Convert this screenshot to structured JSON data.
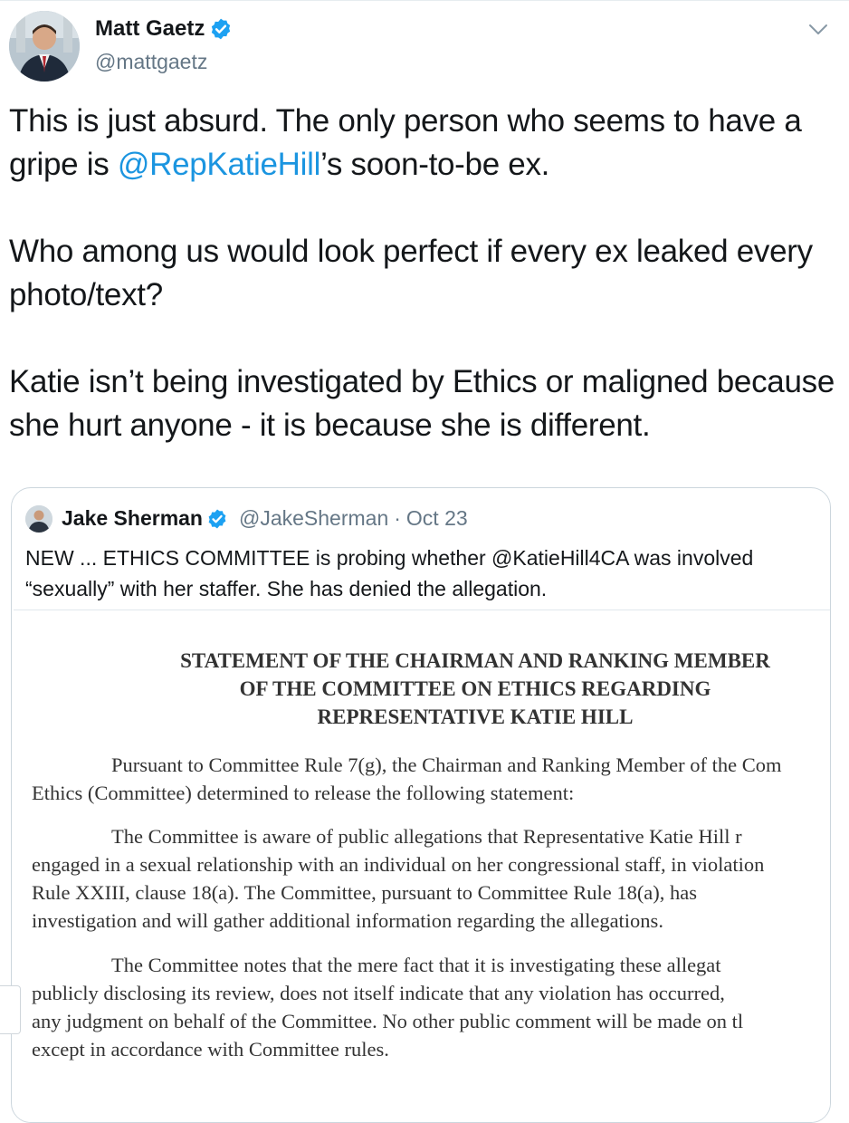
{
  "author": {
    "display_name": "Matt Gaetz",
    "handle": "@mattgaetz"
  },
  "tweet": {
    "p1_before": "This is just absurd. The only person who seems to have a gripe is ",
    "p1_mention": "@RepKatieHill",
    "p1_after": "’s soon-to-be ex.",
    "p2": "Who among us would look perfect if every ex leaked every photo/text?",
    "p3": "Katie isn’t being investigated by Ethics or maligned because she hurt anyone - it is because she is different."
  },
  "quoted": {
    "display_name": "Jake Sherman",
    "handle": "@JakeSherman",
    "separator": "·",
    "date": "Oct 23",
    "text": "NEW ... ETHICS COMMITTEE is probing whether @KatieHill4CA was involved “sexually” with her staffer. She has denied the allegation."
  },
  "document": {
    "title_lines": [
      "STATEMENT OF THE CHAIRMAN AND RANKING MEMBER",
      "OF THE COMMITTEE ON ETHICS REGARDING",
      "REPRESENTATIVE KATIE HILL"
    ],
    "lines": [
      "Pursuant to Committee Rule 7(g), the Chairman and Ranking Member of the Com",
      "Ethics (Committee) determined to release the following statement:",
      "The Committee is aware of public allegations that Representative Katie Hill r",
      "engaged in a sexual relationship with an individual on her congressional staff, in violation",
      "Rule XXIII, clause 18(a).  The Committee, pursuant to Committee Rule 18(a), has",
      "investigation and will gather additional information regarding the allegations.",
      "The Committee notes that the mere fact that it is investigating these allegat",
      "publicly disclosing its review, does not itself indicate that any violation has occurred,",
      "any judgment on behalf of the Committee.  No other public comment will be made on tl",
      "except in accordance with Committee rules."
    ]
  },
  "colors": {
    "mention": "#1b95e0",
    "verified": "#1da1f2",
    "secondary_text": "#657786",
    "border": "#ccd6dd"
  },
  "icons": {
    "verified": "verified-badge-icon",
    "menu": "chevron-down-icon"
  }
}
